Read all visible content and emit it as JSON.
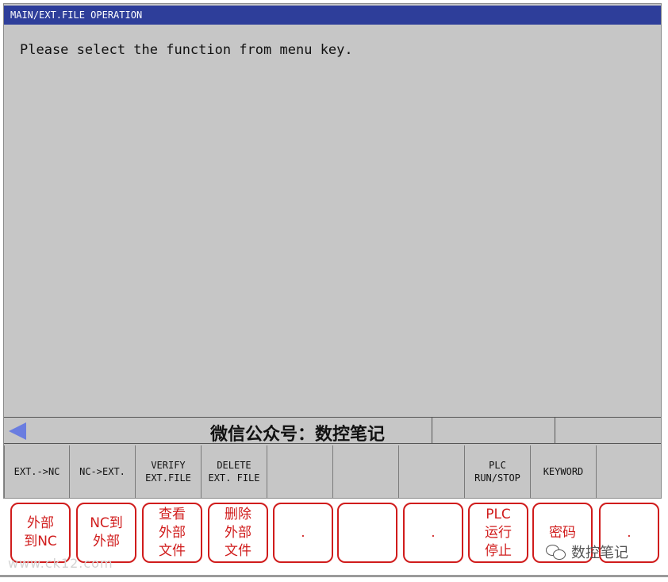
{
  "window": {
    "title": "MAIN/EXT.FILE OPERATION"
  },
  "main": {
    "message": "Please select the function from menu key."
  },
  "status_bar": {
    "back_icon": "left-arrow-icon",
    "text": "微信公众号：数控笔记"
  },
  "softkeys": [
    {
      "label": "EXT.->NC"
    },
    {
      "label": "NC->EXT."
    },
    {
      "label": "VERIFY\nEXT.FILE"
    },
    {
      "label": "DELETE\nEXT. FILE"
    },
    {
      "label": ""
    },
    {
      "label": ""
    },
    {
      "label": ""
    },
    {
      "label": "PLC\nRUN/STOP"
    },
    {
      "label": "KEYWORD"
    },
    {
      "label": ""
    }
  ],
  "captions": [
    {
      "text": "外部\n到NC"
    },
    {
      "text": "NC到\n外部"
    },
    {
      "text": "查看\n外部\n文件"
    },
    {
      "text": "删除\n外部\n文件"
    },
    {
      "text": "."
    },
    {
      "text": ""
    },
    {
      "text": "."
    },
    {
      "text": "PLC\n运行\n停止"
    },
    {
      "text": "密码"
    },
    {
      "text": "."
    }
  ],
  "watermarks": {
    "left": "www.ck12.com",
    "right": "数控笔记",
    "right_icon": "wechat-icon"
  },
  "colors": {
    "title_bar": "#2e3e9a",
    "screen_bg": "#c6c6c6",
    "caption_red": "#d01c1c",
    "arrow": "#6a7de0"
  }
}
